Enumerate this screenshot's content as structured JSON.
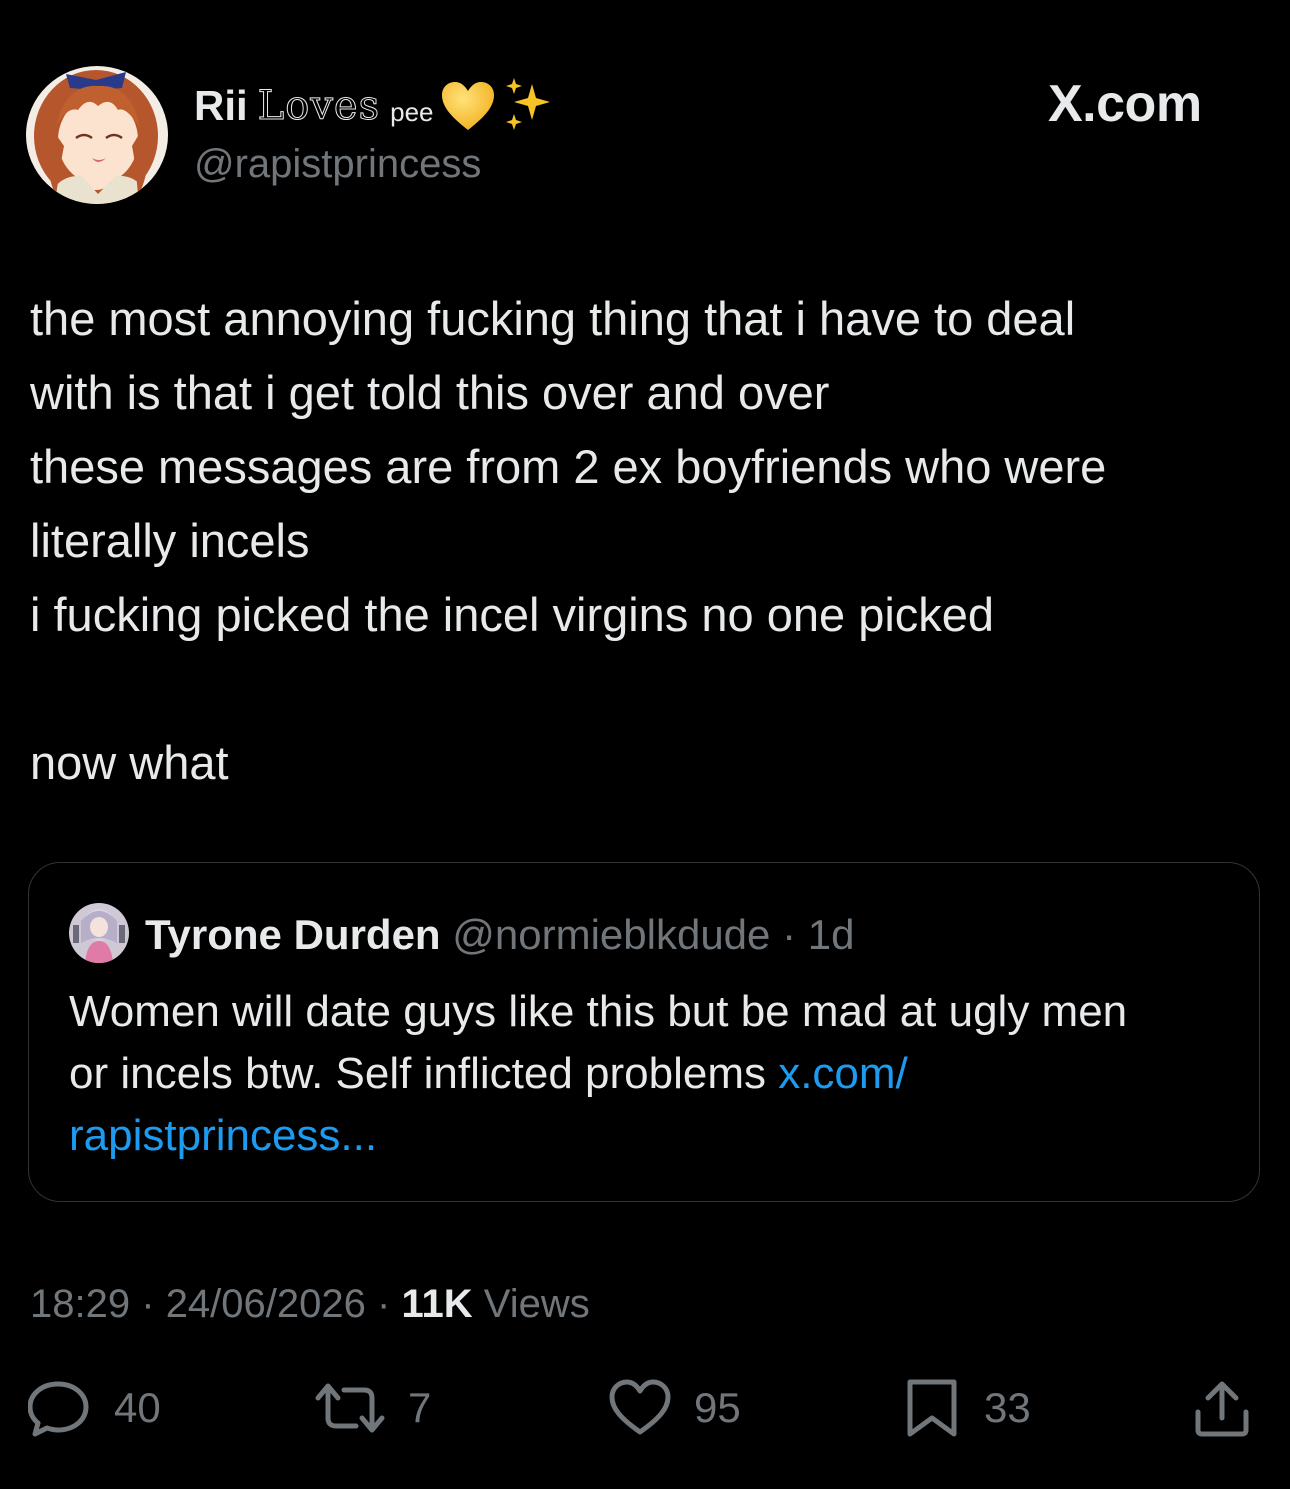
{
  "author": {
    "display_name": "Rii",
    "display_name_styled": "Loves",
    "display_name_suffix": "pee",
    "emoji_1": "yellow-heart",
    "emoji_2": "sparkles",
    "handle": "@rapistprincess"
  },
  "brand": "X.com",
  "tweet": {
    "lines": [
      "the most annoying fucking thing that i have to deal",
      "with is that i get told this over and over",
      "these messages are from 2 ex boyfriends who were",
      "literally incels",
      "i fucking picked the incel virgins no one picked",
      "",
      "now what"
    ]
  },
  "quote": {
    "name": "Tyrone Durden",
    "handle": "@normieblkdude",
    "separator": "·",
    "time": "1d",
    "text_line_1": "Women will date guys like this but be mad at ugly men",
    "text_line_2": "or incels btw. Self inflicted problems ",
    "link_part_1": "x.com/",
    "link_part_2": "rapistprincess..."
  },
  "meta": {
    "time": "18:29",
    "date": "24/06/2026",
    "separator": "·",
    "views_count": "11K",
    "views_label": "Views"
  },
  "actions": {
    "replies": "40",
    "reposts": "7",
    "likes": "95",
    "bookmarks": "33"
  },
  "colors": {
    "background": "#000000",
    "text": "#e7e9ea",
    "secondary": "#71767b",
    "link": "#1d9bf0",
    "border": "#2f3336",
    "heart_emoji": "#f7c325"
  }
}
